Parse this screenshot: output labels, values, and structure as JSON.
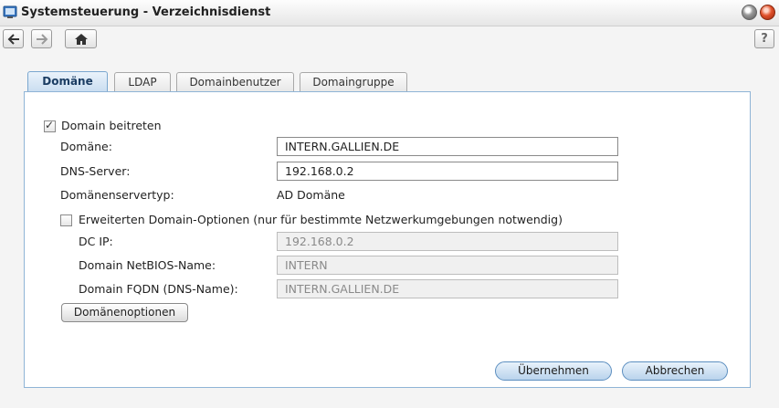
{
  "window": {
    "title": "Systemsteuerung - Verzeichnisdienst"
  },
  "toolbar": {
    "help_label": "?"
  },
  "tabs": [
    {
      "label": "Domäne",
      "active": true
    },
    {
      "label": "LDAP",
      "active": false
    },
    {
      "label": "Domainbenutzer",
      "active": false
    },
    {
      "label": "Domaingruppe",
      "active": false
    }
  ],
  "form": {
    "join_domain": {
      "label": "Domain beitreten",
      "checked": true
    },
    "domain": {
      "label": "Domäne:",
      "value": "INTERN.GALLIEN.DE"
    },
    "dns_server": {
      "label": "DNS-Server:",
      "value": "192.168.0.2"
    },
    "server_type": {
      "label": "Domänenservertyp:",
      "value": "AD Domäne"
    },
    "advanced": {
      "label": "Erweiterten Domain-Optionen (nur für bestimmte Netzwerkumgebungen notwendig)",
      "checked": false
    },
    "dc_ip": {
      "label": "DC IP:",
      "value": "192.168.0.2"
    },
    "netbios": {
      "label": "Domain NetBIOS-Name:",
      "value": "INTERN"
    },
    "fqdn": {
      "label": "Domain FQDN (DNS-Name):",
      "value": "INTERN.GALLIEN.DE"
    },
    "domain_options_button": "Domänenoptionen"
  },
  "actions": {
    "apply": "Übernehmen",
    "cancel": "Abbrechen"
  },
  "colors": {
    "accent": "#7aa7cf",
    "panel_border": "#8fb4d6"
  }
}
